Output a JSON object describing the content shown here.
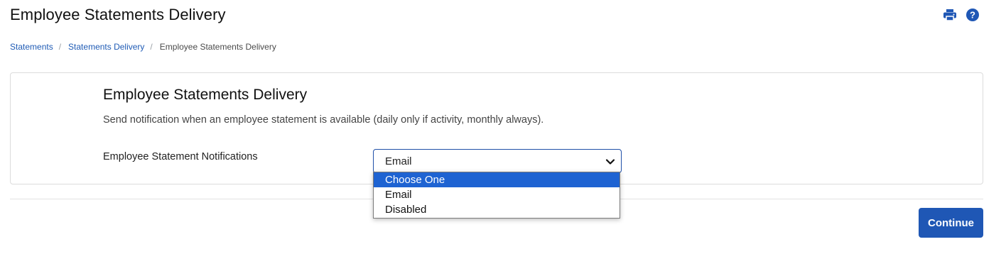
{
  "page": {
    "title": "Employee Statements Delivery"
  },
  "toolbar": {
    "print_icon": "print-icon",
    "help_icon": "help-icon",
    "accent": "#1f57b5"
  },
  "breadcrumb": {
    "items": [
      {
        "label": "Statements"
      },
      {
        "label": "Statements Delivery"
      },
      {
        "label": "Employee Statements Delivery"
      }
    ],
    "separator": "/"
  },
  "card": {
    "title": "Employee Statements Delivery",
    "description": "Send notification when an employee statement is available (daily only if activity, monthly always).",
    "field_label": "Employee Statement Notifications",
    "select": {
      "value": "Email",
      "options": [
        {
          "label": "Choose One",
          "highlighted": true
        },
        {
          "label": "Email",
          "highlighted": false
        },
        {
          "label": "Disabled",
          "highlighted": false
        }
      ]
    }
  },
  "footer": {
    "continue_label": "Continue"
  },
  "colors": {
    "link": "#1f5bb5",
    "highlight": "#1e63d2",
    "button": "#1f57b5"
  }
}
